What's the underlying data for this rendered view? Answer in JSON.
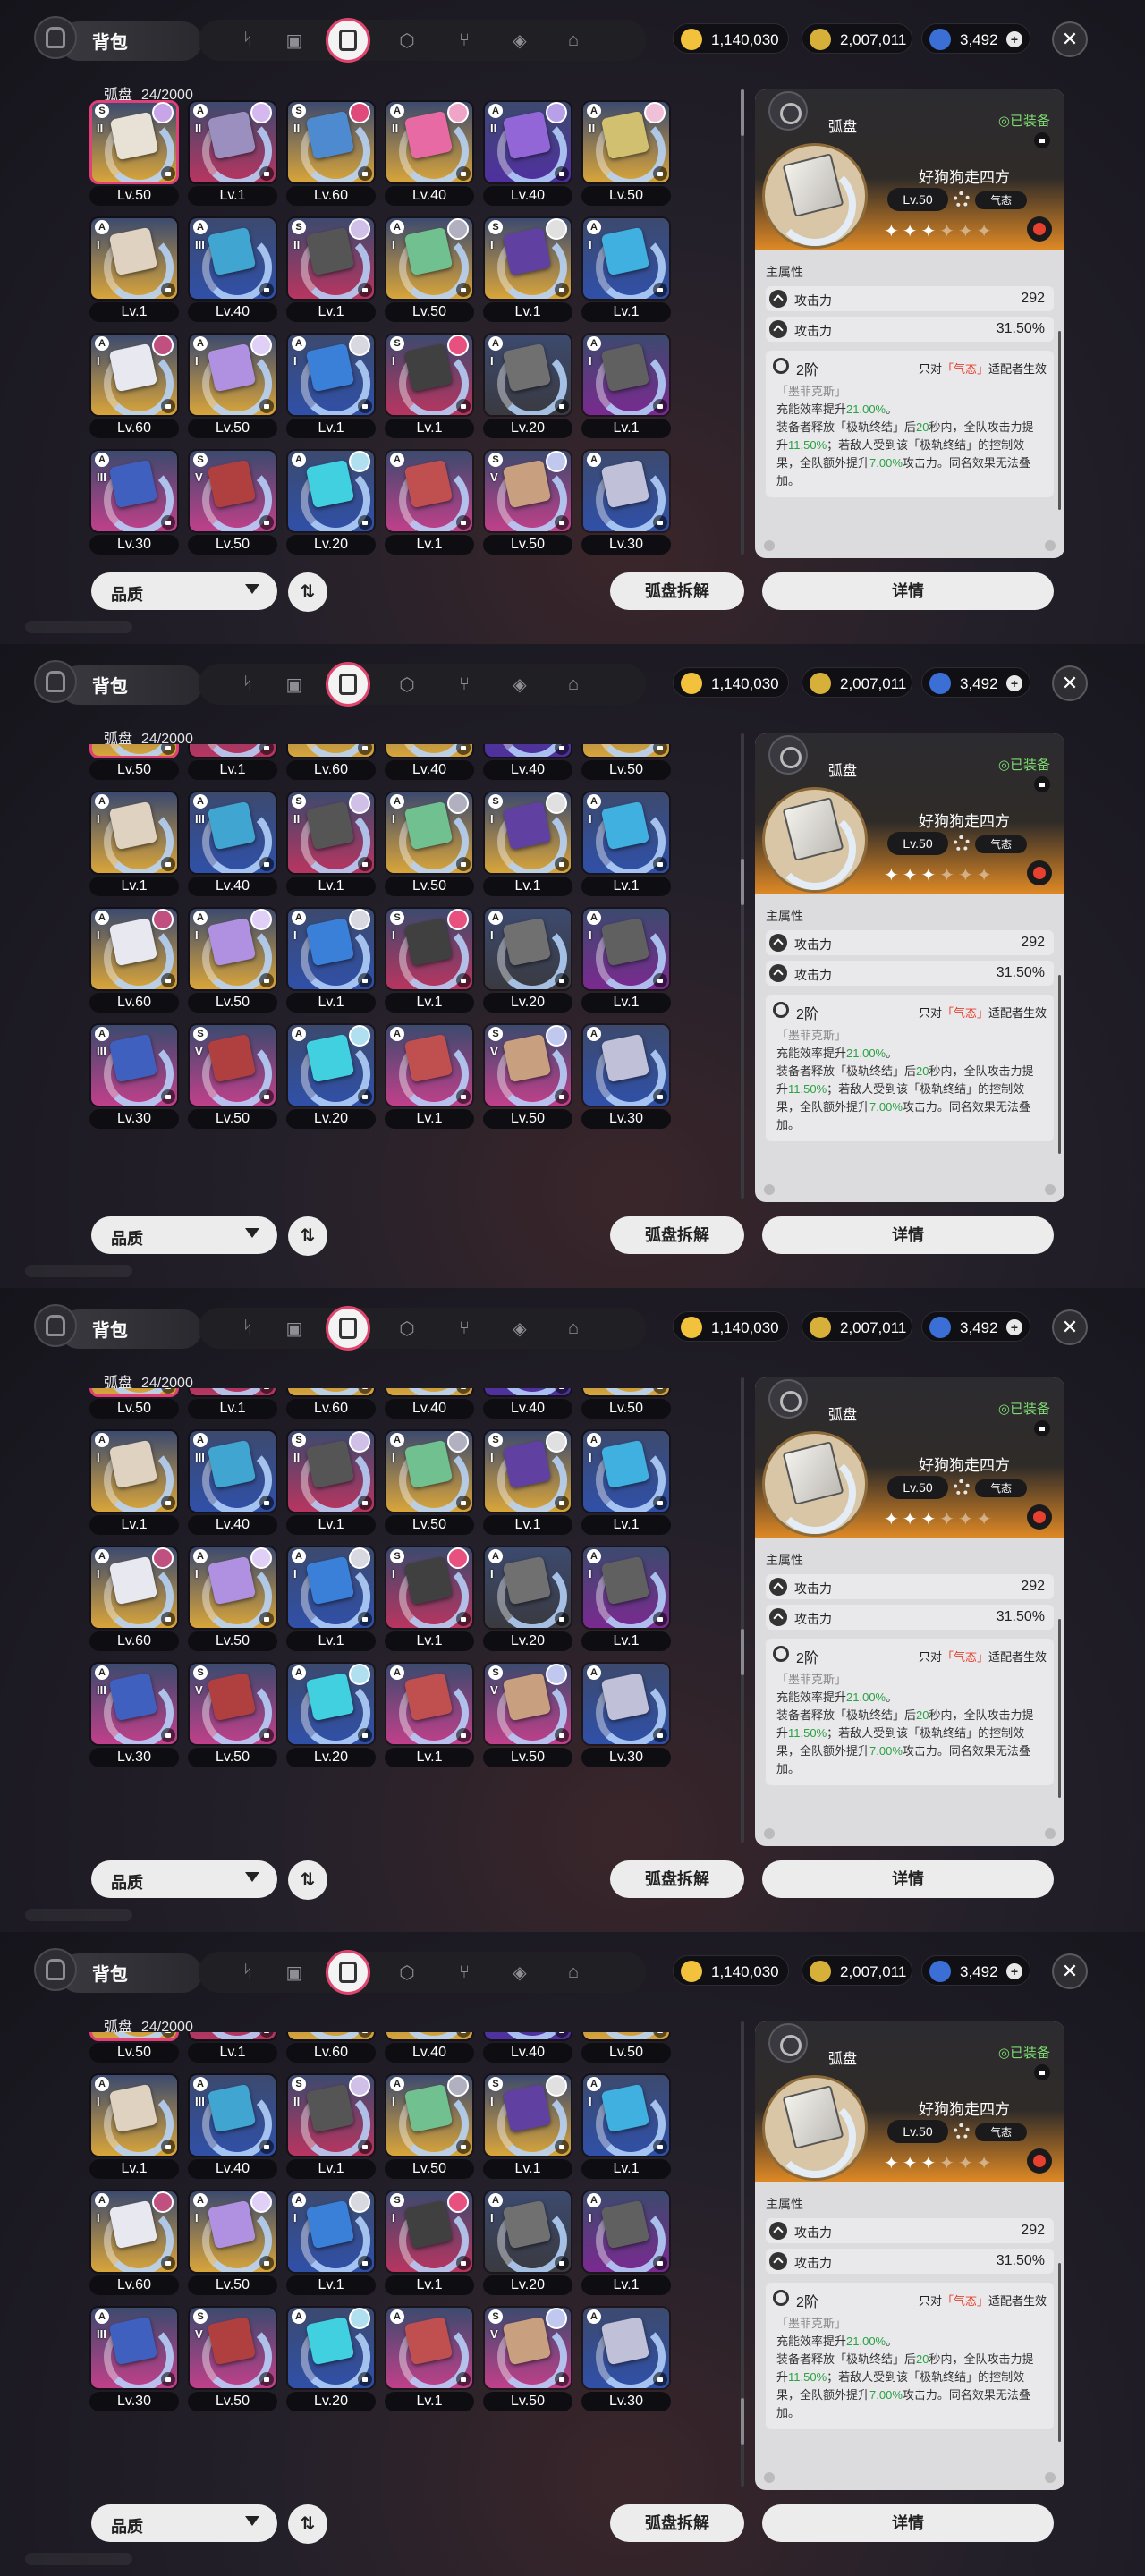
{
  "header": {
    "title": "背包",
    "tabs": [
      {
        "name": "tab-agents",
        "icon": "nodes-icon"
      },
      {
        "name": "tab-bangboo",
        "icon": "device-icon"
      },
      {
        "name": "tab-wengine",
        "icon": "card-icon",
        "active": true
      },
      {
        "name": "tab-cube",
        "icon": "cube-icon"
      },
      {
        "name": "tab-food",
        "icon": "utensils-icon"
      },
      {
        "name": "tab-materials",
        "icon": "box-icon"
      },
      {
        "name": "tab-home",
        "icon": "home-icon"
      }
    ],
    "currencies": [
      {
        "name": "gold",
        "value": "1,140,030",
        "color": "#f2c23c"
      },
      {
        "name": "ticket",
        "value": "2,007,011",
        "color": "#d7b03a"
      },
      {
        "name": "crystal",
        "value": "3,492",
        "color": "#3b6fd6"
      }
    ],
    "close_icon": "✕"
  },
  "inventory": {
    "category": "弧盘",
    "count": "24/2000"
  },
  "items": [
    {
      "lv": "Lv.50",
      "rank": "S",
      "roman": "II",
      "bg": "#d9a53a",
      "art": "#e7e1d6",
      "avatar": "#c8a5e8",
      "selected": true
    },
    {
      "lv": "Lv.1",
      "rank": "A",
      "roman": "II",
      "bg": "#b83560",
      "art": "#9b8fbf",
      "avatar": "#d6b8f0"
    },
    {
      "lv": "Lv.60",
      "rank": "S",
      "roman": "II",
      "bg": "#d9a53a",
      "art": "#4e8ad0",
      "avatar": "#e04a7a"
    },
    {
      "lv": "Lv.40",
      "rank": "A",
      "roman": "II",
      "bg": "#d9a53a",
      "art": "#e76aa5",
      "avatar": "#f0a5c8"
    },
    {
      "lv": "Lv.40",
      "rank": "A",
      "roman": "II",
      "bg": "#5030a0",
      "art": "#9266d6",
      "avatar": "#b8a0e8"
    },
    {
      "lv": "Lv.50",
      "rank": "A",
      "roman": "II",
      "bg": "#d9a53a",
      "art": "#d0c070",
      "avatar": "#f0c0d8"
    },
    {
      "lv": "Lv.1",
      "rank": "A",
      "roman": "I",
      "bg": "#d9a53a",
      "art": "#e0d2c0",
      "avatar": ""
    },
    {
      "lv": "Lv.40",
      "rank": "A",
      "roman": "III",
      "bg": "#3050a8",
      "art": "#40a5d0",
      "avatar": ""
    },
    {
      "lv": "Lv.1",
      "rank": "S",
      "roman": "II",
      "bg": "#b83560",
      "art": "#555555",
      "avatar": "#d0c0e8"
    },
    {
      "lv": "Lv.50",
      "rank": "A",
      "roman": "I",
      "bg": "#d9a53a",
      "art": "#70c090",
      "avatar": "#b0b0c0"
    },
    {
      "lv": "Lv.1",
      "rank": "S",
      "roman": "I",
      "bg": "#d9a53a",
      "art": "#6040a0",
      "avatar": "#e0e0e0"
    },
    {
      "lv": "Lv.1",
      "rank": "A",
      "roman": "I",
      "bg": "#3050a8",
      "art": "#40b0e0",
      "avatar": ""
    },
    {
      "lv": "Lv.60",
      "rank": "A",
      "roman": "I",
      "bg": "#d9a53a",
      "art": "#e8e8f0",
      "avatar": "#c05080"
    },
    {
      "lv": "Lv.50",
      "rank": "A",
      "roman": "I",
      "bg": "#d9a53a",
      "art": "#b090e0",
      "avatar": "#e0d0f8"
    },
    {
      "lv": "Lv.1",
      "rank": "A",
      "roman": "I",
      "bg": "#3050a8",
      "art": "#3a80d8",
      "avatar": "#d8d8e0"
    },
    {
      "lv": "Lv.1",
      "rank": "S",
      "roman": "I",
      "bg": "#b83560",
      "art": "#404040",
      "avatar": "#e85080"
    },
    {
      "lv": "Lv.20",
      "rank": "A",
      "roman": "I",
      "bg": "#3a3a40",
      "art": "#707070",
      "avatar": ""
    },
    {
      "lv": "Lv.1",
      "rank": "A",
      "roman": "I",
      "bg": "#7a2a90",
      "art": "#606060",
      "avatar": ""
    },
    {
      "lv": "Lv.30",
      "rank": "A",
      "roman": "III",
      "bg": "#c0408a",
      "art": "#4060c0",
      "avatar": ""
    },
    {
      "lv": "Lv.50",
      "rank": "S",
      "roman": "V",
      "bg": "#c0408a",
      "art": "#b04040",
      "avatar": ""
    },
    {
      "lv": "Lv.20",
      "rank": "A",
      "roman": "",
      "bg": "#3050a8",
      "art": "#40d0e0",
      "avatar": "#b0e0f0"
    },
    {
      "lv": "Lv.1",
      "rank": "A",
      "roman": "",
      "bg": "#c0408a",
      "art": "#c05050",
      "avatar": ""
    },
    {
      "lv": "Lv.50",
      "rank": "S",
      "roman": "V",
      "bg": "#c0408a",
      "art": "#c8a080",
      "avatar": "#c0c8f0"
    },
    {
      "lv": "Lv.30",
      "rank": "A",
      "roman": "",
      "bg": "#3050a8",
      "art": "#c0c0d8",
      "avatar": ""
    }
  ],
  "panels": [
    {
      "scroll_offset_rows": 0,
      "thumb_frac": 0.0
    },
    {
      "scroll_offset_rows": 0.6,
      "thumb_frac": 0.3
    },
    {
      "scroll_offset_rows": 0.65,
      "thumb_frac": 0.6
    },
    {
      "scroll_offset_rows": 0.65,
      "thumb_frac": 0.9
    }
  ],
  "detail": {
    "category": "弧盘",
    "equipped": "◎已装备",
    "name": "好狗狗走四方",
    "level": "Lv.50",
    "element": "气态",
    "stars_on": "✦✦✦",
    "stars_off": "✦✦✦",
    "main_stat_title": "主属性",
    "stats": [
      {
        "key": "攻击力",
        "value": "292"
      },
      {
        "key": "攻击力",
        "value": "31.50%"
      }
    ],
    "skill": {
      "tier": "2阶",
      "req_prefix": "只对",
      "req_hl": "「气态」",
      "req_suffix": "适配者生效",
      "quote": "「墨菲克斯」",
      "line1_pre": "充能效率提升",
      "line1_g": "21.00%",
      "line1_post": "。",
      "line2_pre": "装备者释放「极轨终结」后",
      "line2_g": "20",
      "line2_post": "秒内，全队攻击力提升",
      "line3_g": "11.50%",
      "line3_post": "；若敌人受到该「极轨终结」的控制效果，全队额外提升",
      "line4_g": "7.00%",
      "line4_post": "攻击力。同名效果无法叠加。"
    }
  },
  "bottom": {
    "sort_label": "品质",
    "order_icon": "⇅",
    "dismantle_label": "弧盘拆解",
    "detail_label": "详情"
  }
}
